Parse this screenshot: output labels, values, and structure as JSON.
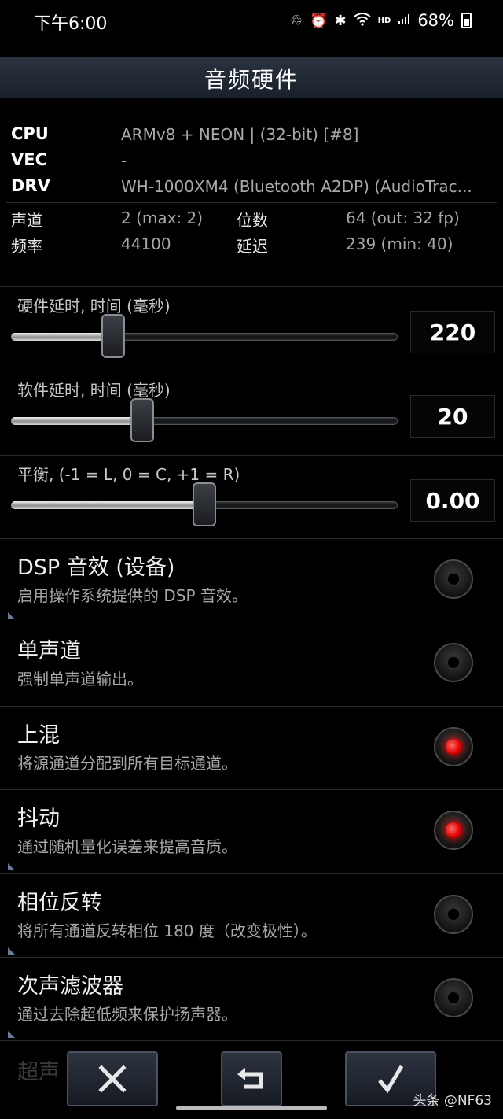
{
  "status_bar": {
    "time": "下午6:00",
    "hd": "HD",
    "battery": "68%"
  },
  "header": {
    "title": "音频硬件"
  },
  "info": {
    "rows": [
      {
        "label": "CPU",
        "value": "ARMv8 + NEON | (32-bit) [#8]"
      },
      {
        "label": "VEC",
        "value": "-"
      },
      {
        "label": "DRV",
        "value": "WH-1000XM4 (Bluetooth A2DP) (AudioTrac..."
      }
    ],
    "grid": [
      {
        "label": "声道",
        "value": "2 (max: 2)",
        "label2": "位数",
        "value2": "64 (out: 32 fp)"
      },
      {
        "label": "频率",
        "value": "44100",
        "label2": "延迟",
        "value2": "239 (min: 40)"
      }
    ]
  },
  "sliders": [
    {
      "label": "硬件延时, 时间 (毫秒)",
      "value": "220",
      "fraction": 0.265
    },
    {
      "label": "软件延时, 时间 (毫秒)",
      "value": "20",
      "fraction": 0.34
    },
    {
      "label": "平衡, (-1 = L, 0 = C, +1 = R)",
      "value": "0.00",
      "fraction": 0.5
    }
  ],
  "toggles": [
    {
      "title": "DSP 音效 (设备)",
      "desc": "启用操作系统提供的 DSP 音效。",
      "on": false
    },
    {
      "title": "单声道",
      "desc": "强制单声道输出。",
      "on": false
    },
    {
      "title": "上混",
      "desc": "将源通道分配到所有目标通道。",
      "on": true
    },
    {
      "title": "抖动",
      "desc": "通过随机量化误差来提高音质。",
      "on": true
    },
    {
      "title": "相位反转",
      "desc": "将所有通道反转相位 180 度（改变极性）。",
      "on": false
    },
    {
      "title": "次声滤波器",
      "desc": "通过去除超低频来保护扬声器。",
      "on": false
    }
  ],
  "bottom": {
    "partial_text": "超声",
    "watermark": "头条 @NF63",
    "buttons": [
      "close-icon",
      "undo-icon",
      "check-icon"
    ]
  },
  "colors": {
    "accent_on": "#ff0000",
    "title_bar": "#1f2630"
  }
}
